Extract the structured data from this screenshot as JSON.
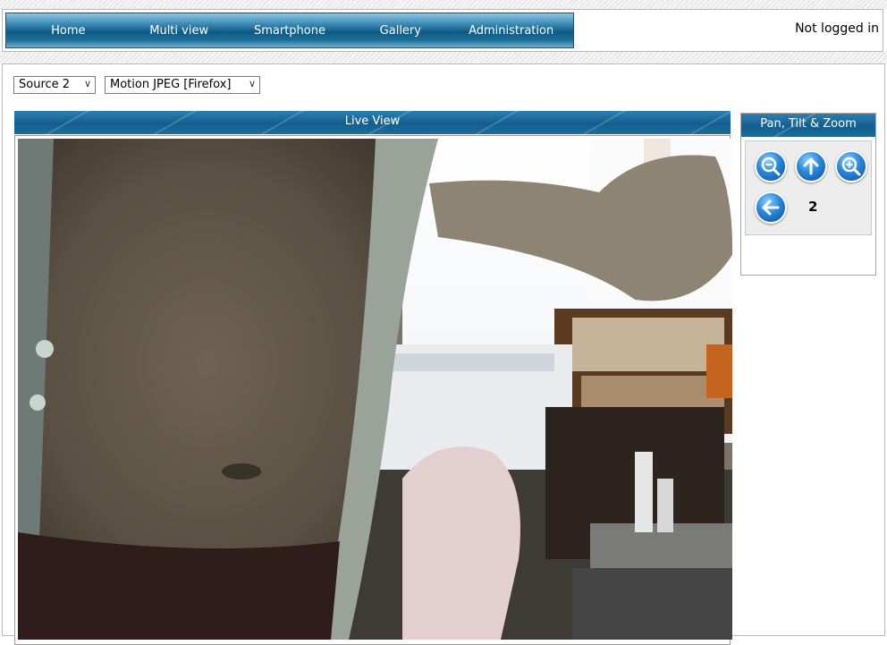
{
  "nav": {
    "items": [
      {
        "label": "Home"
      },
      {
        "label": "Multi view"
      },
      {
        "label": "Smartphone"
      },
      {
        "label": "Gallery"
      },
      {
        "label": "Administration"
      }
    ]
  },
  "status": {
    "login": "Not logged in"
  },
  "controls": {
    "source_select": {
      "selected": "Source 2"
    },
    "format_select": {
      "selected": "Motion JPEG [Firefox]"
    }
  },
  "live_view": {
    "title": "Live View"
  },
  "ptz": {
    "title": "Pan, Tilt & Zoom",
    "preset_label": "2",
    "icons": [
      "zoom-out-icon",
      "arrow-up-icon",
      "zoom-in-icon",
      "arrow-left-icon"
    ]
  },
  "colors": {
    "nav_bar": "#0f5a85",
    "title_bar": "#1d6c9c",
    "button_blue": "#2a86d8"
  }
}
